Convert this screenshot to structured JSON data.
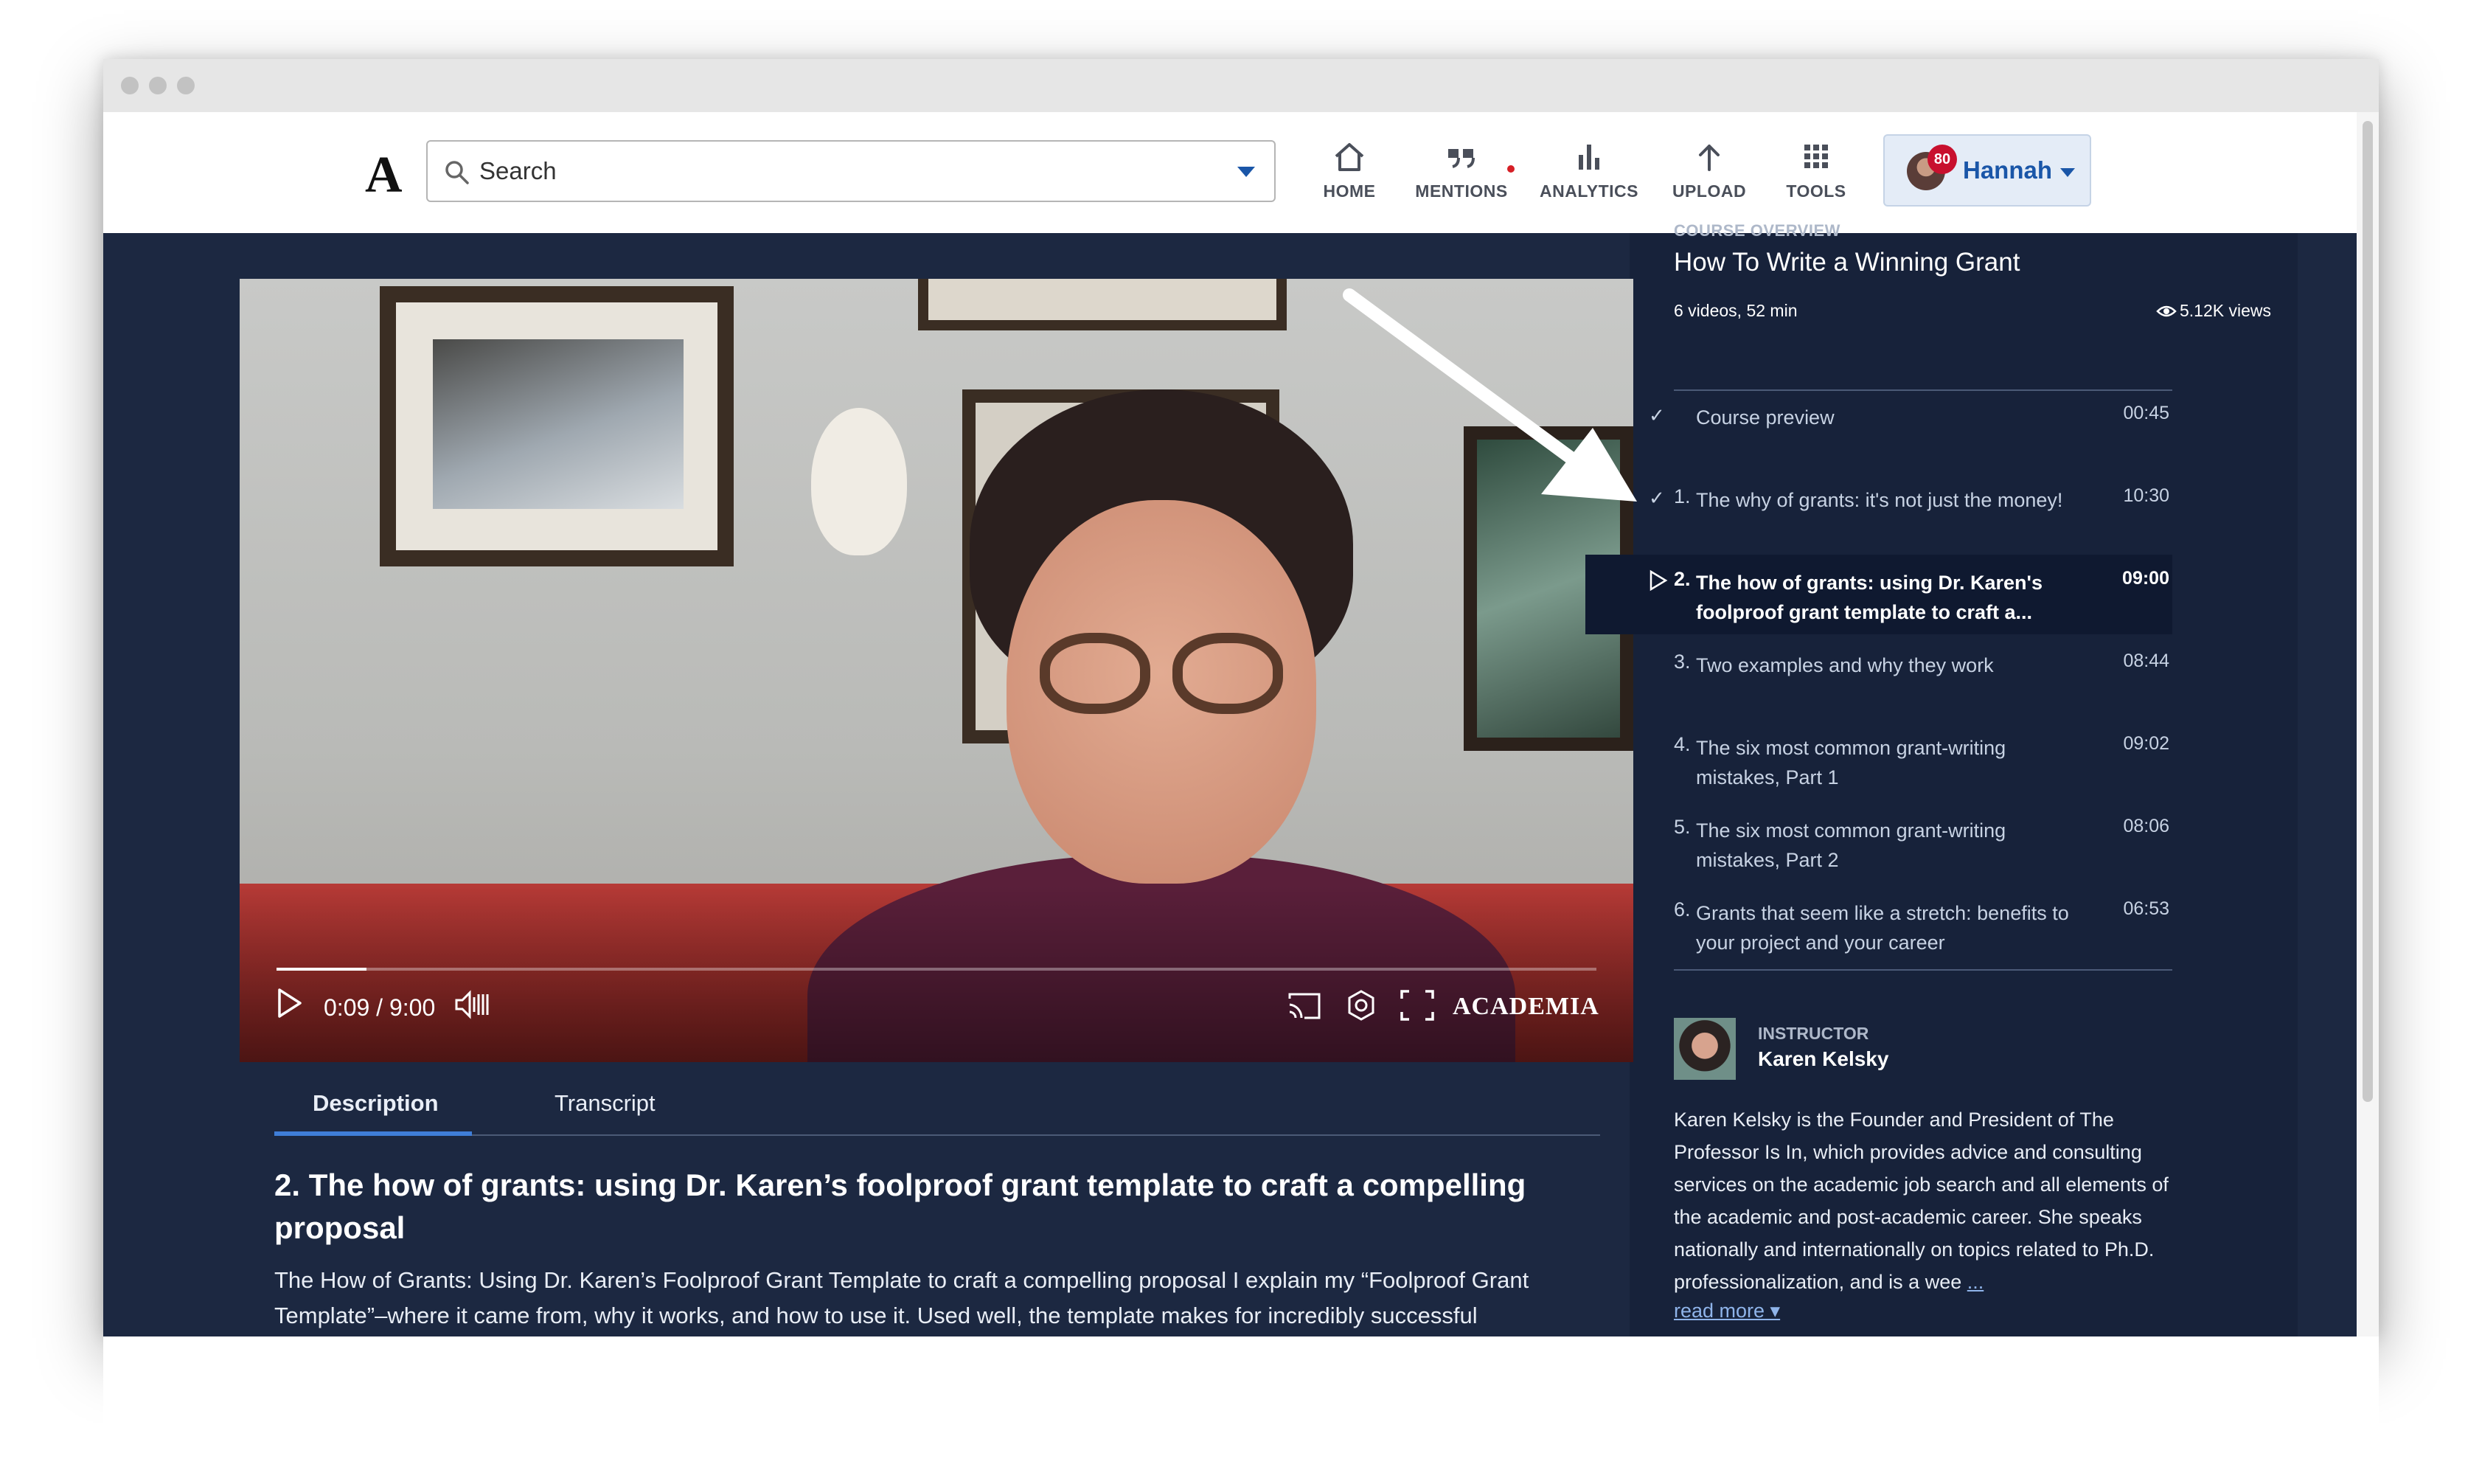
{
  "nav": {
    "logo": "A",
    "search_placeholder": "Search",
    "items": [
      {
        "label": "HOME",
        "icon": "home-icon"
      },
      {
        "label": "MENTIONS",
        "icon": "quote-icon"
      },
      {
        "label": "ANALYTICS",
        "icon": "bar-chart-icon"
      },
      {
        "label": "UPLOAD",
        "icon": "upload-arrow-icon"
      },
      {
        "label": "TOOLS",
        "icon": "grid-icon"
      }
    ],
    "user": {
      "name": "Hannah",
      "badge": "80"
    }
  },
  "player": {
    "time": "0:09 / 9:00",
    "progress_fraction": 0.017,
    "brand": "ACADEMIA"
  },
  "tabs": [
    "Description",
    "Transcript"
  ],
  "description": {
    "title": "2. The how of grants: using Dr. Karen’s foolproof grant template to craft a compelling proposal",
    "body": "The How of Grants: Using Dr. Karen’s Foolproof Grant Template to craft a compelling proposal  I explain my “Foolproof Grant Template”–where it came from, why it works, and how to use it. Used well, the template makes for incredibly successful"
  },
  "course": {
    "overline": "COURSE OVERVIEW",
    "title": "How To Write a Winning Grant",
    "meta": "6 videos, 52 min",
    "views": "5.12K views",
    "lessons": [
      {
        "num": "",
        "title": "Course preview",
        "duration": "00:45",
        "state": "done"
      },
      {
        "num": "1.",
        "title": "The why of grants: it's not just the money!",
        "duration": "10:30",
        "state": "done"
      },
      {
        "num": "2.",
        "title": "The how of grants: using Dr. Karen's foolproof grant template to craft a...",
        "duration": "09:00",
        "state": "playing"
      },
      {
        "num": "3.",
        "title": "Two examples and why they work",
        "duration": "08:44",
        "state": ""
      },
      {
        "num": "4.",
        "title": "The six most common grant-writing mistakes, Part 1",
        "duration": "09:02",
        "state": ""
      },
      {
        "num": "5.",
        "title": "The six most common grant-writing mistakes, Part 2",
        "duration": "08:06",
        "state": ""
      },
      {
        "num": "6.",
        "title": "Grants that seem like a stretch: benefits to your project and your career",
        "duration": "06:53",
        "state": ""
      }
    ]
  },
  "instructor": {
    "label": "INSTRUCTOR",
    "name": "Karen Kelsky",
    "bio": "Karen Kelsky is the Founder and President of The Professor Is In, which provides advice and consulting services on the academic job search and all elements of the academic and post-academic career. She speaks nationally and internationally on topics related to Ph.D. professionalization, and is a wee",
    "bio_more": "...",
    "read_more": "read more ▾"
  },
  "colors": {
    "page_bg": "#1c2841",
    "sidebar_bg": "#17223a",
    "accent": "#1a56a8",
    "tab_underline": "#3f7ed8",
    "badge": "#c8102e"
  }
}
